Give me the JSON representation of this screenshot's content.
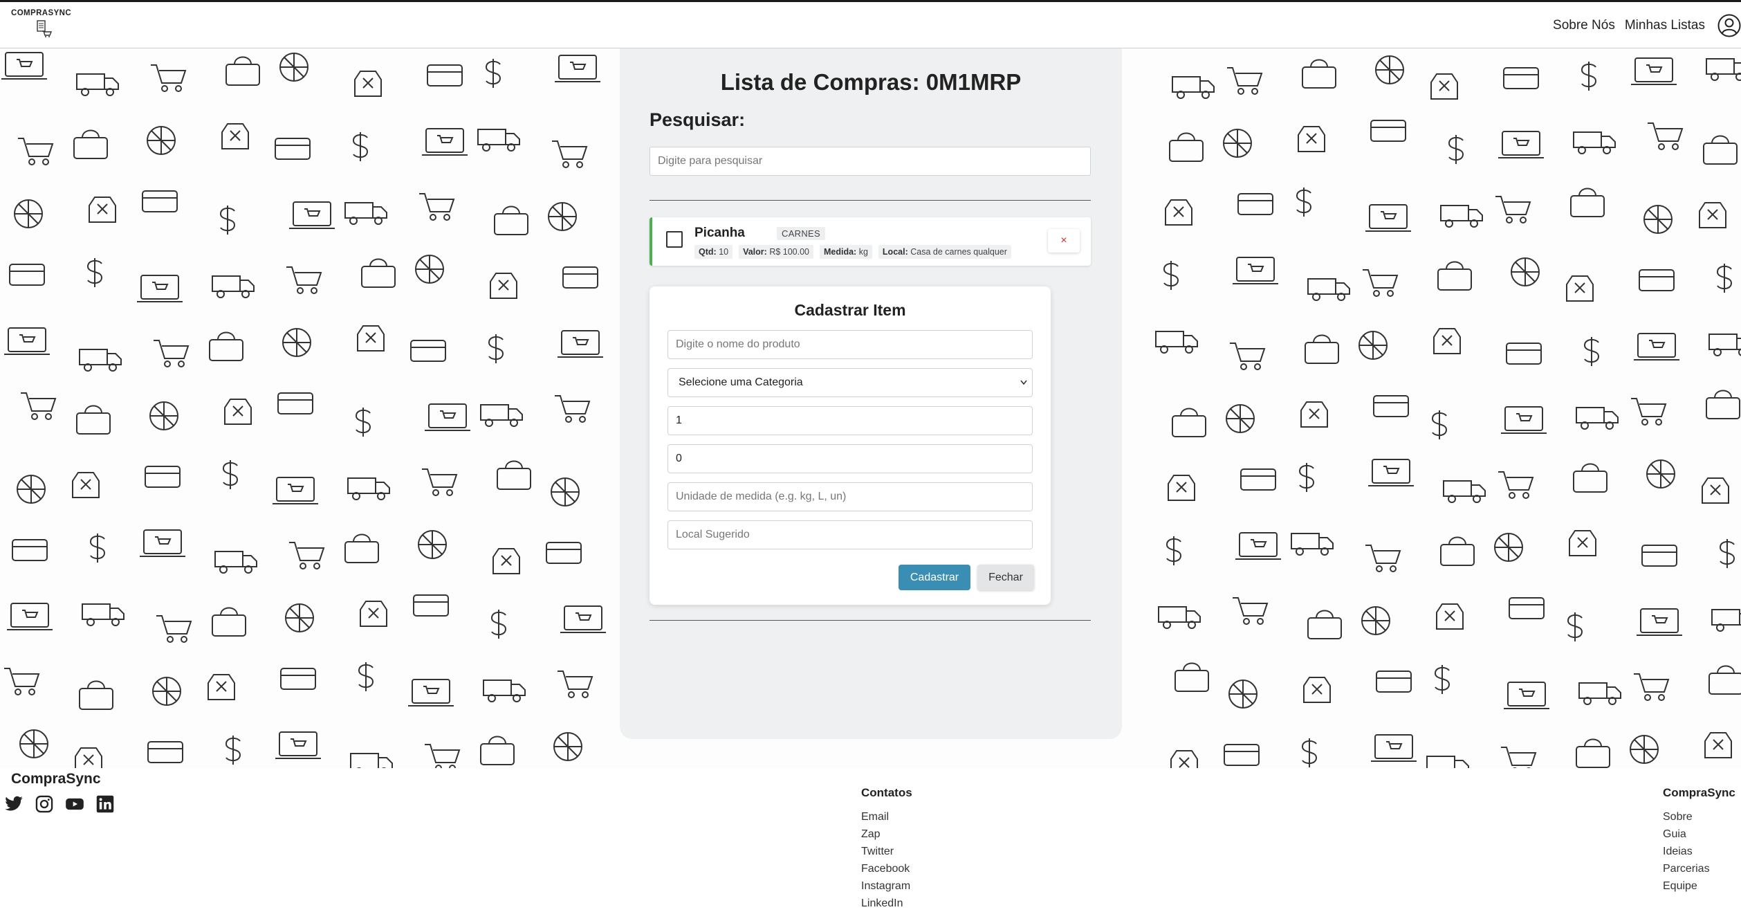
{
  "header": {
    "logo_text": "COMPRASYNC",
    "nav": [
      {
        "label": "Sobre Nós"
      },
      {
        "label": "Minhas Listas"
      }
    ]
  },
  "list": {
    "title": "Lista de Compras: 0M1MRP",
    "search_label": "Pesquisar:",
    "search_placeholder": "Digite para pesquisar"
  },
  "items": [
    {
      "name": "Picanha",
      "category": "CARNES",
      "qtd_label": "Qtd:",
      "qtd": "10",
      "valor_label": "Valor:",
      "valor": "R$ 100.00",
      "medida_label": "Medida:",
      "medida": "kg",
      "local_label": "Local:",
      "local": "Casa de carnes qualquer",
      "delete_symbol": "×",
      "checked": false,
      "accent_color": "#4caf50"
    }
  ],
  "form": {
    "title": "Cadastrar Item",
    "name_placeholder": "Digite o nome do produto",
    "category_selected": "Selecione uma Categoria",
    "quantity_value": "1",
    "price_value": "0",
    "unit_placeholder": "Unidade de medida (e.g. kg, L, un)",
    "local_placeholder": "Local Sugerido",
    "submit_label": "Cadastrar",
    "close_label": "Fechar"
  },
  "footer": {
    "brand": "CompraSync",
    "social_icons": [
      "twitter-icon",
      "instagram-icon",
      "youtube-icon",
      "linkedin-icon"
    ],
    "contacts": {
      "heading": "Contatos",
      "links": [
        "Email",
        "Zap",
        "Twitter",
        "Facebook",
        "Instagram",
        "LinkedIn"
      ]
    },
    "company": {
      "heading": "CompraSync",
      "links": [
        "Sobre",
        "Guia",
        "Ideias",
        "Parcerias",
        "Equipe"
      ]
    }
  },
  "colors": {
    "primary_button": "#3a8eb4",
    "delete": "#e02b2b",
    "panel_bg": "#eef0f1"
  }
}
